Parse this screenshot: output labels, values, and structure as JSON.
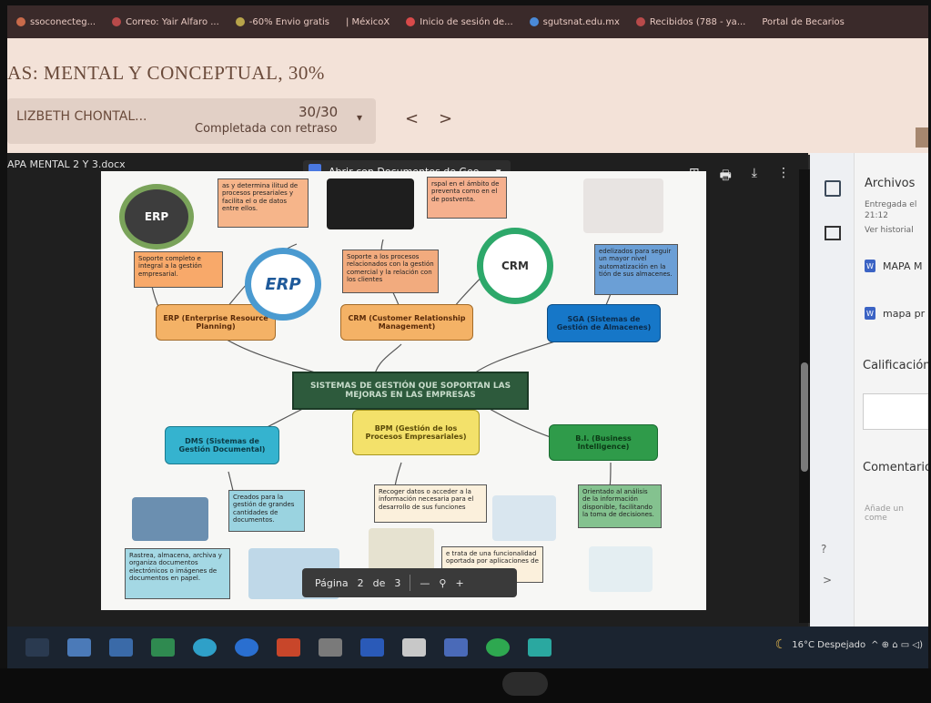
{
  "bookmarks": [
    {
      "label": "ssoconecteg...",
      "color": "#c86a4a"
    },
    {
      "label": "Correo: Yair Alfaro ...",
      "color": "#b84a4a"
    },
    {
      "label": "-60% Envio gratis",
      "color": "#b8a44a"
    },
    {
      "label": "| MéxicoX",
      "color": "#8a8a8a"
    },
    {
      "label": "Inicio de sesión de...",
      "color": "#d84a4a"
    },
    {
      "label": "sgutsnat.edu.mx",
      "color": "#4a8ad8"
    },
    {
      "label": "Recibidos (788 - ya...",
      "color": "#b84a4a"
    },
    {
      "label": "Portal de Becarios",
      "color": "#777777"
    }
  ],
  "assignment": {
    "title": "AS: MENTAL Y CONCEPTUAL, 30%"
  },
  "student": {
    "name": "LIZBETH CHONTAL...",
    "grade": "30/30",
    "status": "Completada con retraso",
    "caret": "▾"
  },
  "nav": {
    "prev": "<",
    "next": ">"
  },
  "viewer": {
    "filename": "APA MENTAL 2 Y 3.docx",
    "open_with": "Abrir con Documentos de Goo...",
    "open_caret": "▾",
    "tools": [
      "⊞",
      "🖶",
      "⤓",
      "⋮"
    ]
  },
  "mindmap": {
    "center": "SISTEMAS DE GESTIÓN QUE SOPORTAN LAS MEJORAS EN LAS EMPRESAS",
    "erp": "ERP (Enterprise Resource Planning)",
    "crm": "CRM (Customer Relationship Management)",
    "sga": "SGA (Sistemas de Gestión de Almacenes)",
    "dms": "DMS (Sistemas de Gestión Documental)",
    "bpm": "BPM (Gestión de los Procesos Empresariales)",
    "bi": "B.I. (Business Intelligence)",
    "erp_logo": "ERP",
    "erp_logo2": "ERP",
    "crm_logo": "CRM",
    "notes": {
      "erp_top": "as y determina ilitud de procesos presariales y facilita el o de datos entre ellos.",
      "erp_support": "Soporte completo e integral a la gestión empresarial.",
      "crm_top": "rspal en el ámbito de preventa como en el de postventa.",
      "crm_support": "Soporte a los procesos relacionados con la gestión comercial y la relación con los clientes",
      "sga_top": "edelizados para seguir un mayor nivel automatización en la tión de sus almacenes.",
      "dms_created": "Creados para la gestión de grandes cantidades de documentos.",
      "dms_track": "Rastrea, almacena, archiva y organiza documentos electrónicos o imágenes de documentos en papel.",
      "bpm_collect": "Recoger datos o acceder a la información necesaria para el desarrollo de sus funciones",
      "bpm_func": "e trata de una funcionalidad oportada por aplicaciones de",
      "bi_orient": "Orientado al análisis de la información disponible, facilitando la toma de decisiones."
    }
  },
  "page_control": {
    "label": "Página",
    "current": "2",
    "of": "de",
    "total": "3",
    "minus": "—",
    "zoom_icon": "⚲",
    "plus": "+"
  },
  "side_panel": {
    "files_title": "Archivos",
    "submitted": "Entregada el 21:12",
    "history": "Ver historial",
    "files": [
      {
        "name": "MAPA M"
      },
      {
        "name": "mapa pr"
      }
    ],
    "grade_title": "Calificación",
    "comments_title": "Comentarios",
    "comment_placeholder": "Añade un come",
    "help": "?",
    "expand": ">"
  },
  "tray": {
    "weather": "16°C Despejado",
    "moon": "☾",
    "icons": "^ ⊕ ⌂ ▭ ◁)"
  }
}
